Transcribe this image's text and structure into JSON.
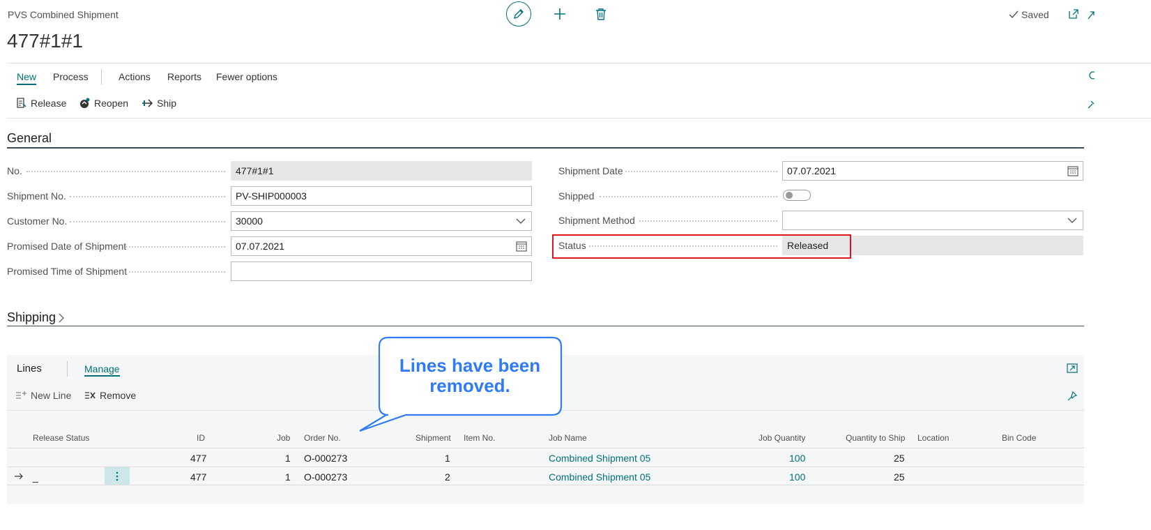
{
  "header": {
    "caption": "PVS Combined Shipment",
    "title": "477#1#1",
    "saved_label": "Saved"
  },
  "menu": {
    "items": [
      {
        "label": "New"
      },
      {
        "label": "Process"
      },
      {
        "label": "Actions"
      },
      {
        "label": "Reports"
      },
      {
        "label": "Fewer options"
      }
    ]
  },
  "actions": {
    "release": "Release",
    "reopen": "Reopen",
    "ship": "Ship"
  },
  "general": {
    "title": "General",
    "no_label": "No.",
    "no_value": "477#1#1",
    "shipment_no_label": "Shipment No.",
    "shipment_no_value": "PV-SHIP000003",
    "customer_no_label": "Customer No.",
    "customer_no_value": "30000",
    "promised_date_label": "Promised Date of Shipment",
    "promised_date_value": "07.07.2021",
    "promised_time_label": "Promised Time of Shipment",
    "promised_time_value": "",
    "shipment_date_label": "Shipment Date",
    "shipment_date_value": "07.07.2021",
    "shipped_label": "Shipped",
    "shipped_value": false,
    "shipment_method_label": "Shipment Method",
    "shipment_method_value": "",
    "status_label": "Status",
    "status_value": "Released"
  },
  "shipping": {
    "title": "Shipping"
  },
  "lines": {
    "title": "Lines",
    "manage": "Manage",
    "new_line": "New Line",
    "remove": "Remove",
    "columns": [
      "Release Status",
      "ID",
      "Job",
      "Order No.",
      "Shipment",
      "Item No.",
      "Job Name",
      "Job Quantity",
      "Quantity to Ship",
      "Location",
      "Bin Code"
    ],
    "rows": [
      {
        "release_status": "",
        "id": "477",
        "job": "1",
        "order_no": "O-000273",
        "shipment": "1",
        "item_no": "",
        "job_name": "Combined Shipment 05",
        "job_quantity": "100",
        "qty_to_ship": "25",
        "location": "",
        "bin_code": ""
      },
      {
        "release_status": "_",
        "id": "477",
        "job": "1",
        "order_no": "O-000273",
        "shipment": "2",
        "item_no": "",
        "job_name": "Combined Shipment 05",
        "job_quantity": "100",
        "qty_to_ship": "25",
        "location": "",
        "bin_code": ""
      }
    ]
  },
  "callout": {
    "text": "Lines have been removed."
  },
  "colors": {
    "accent": "#00717a",
    "highlight": "#e0161b",
    "callout": "#2f7bf5"
  }
}
